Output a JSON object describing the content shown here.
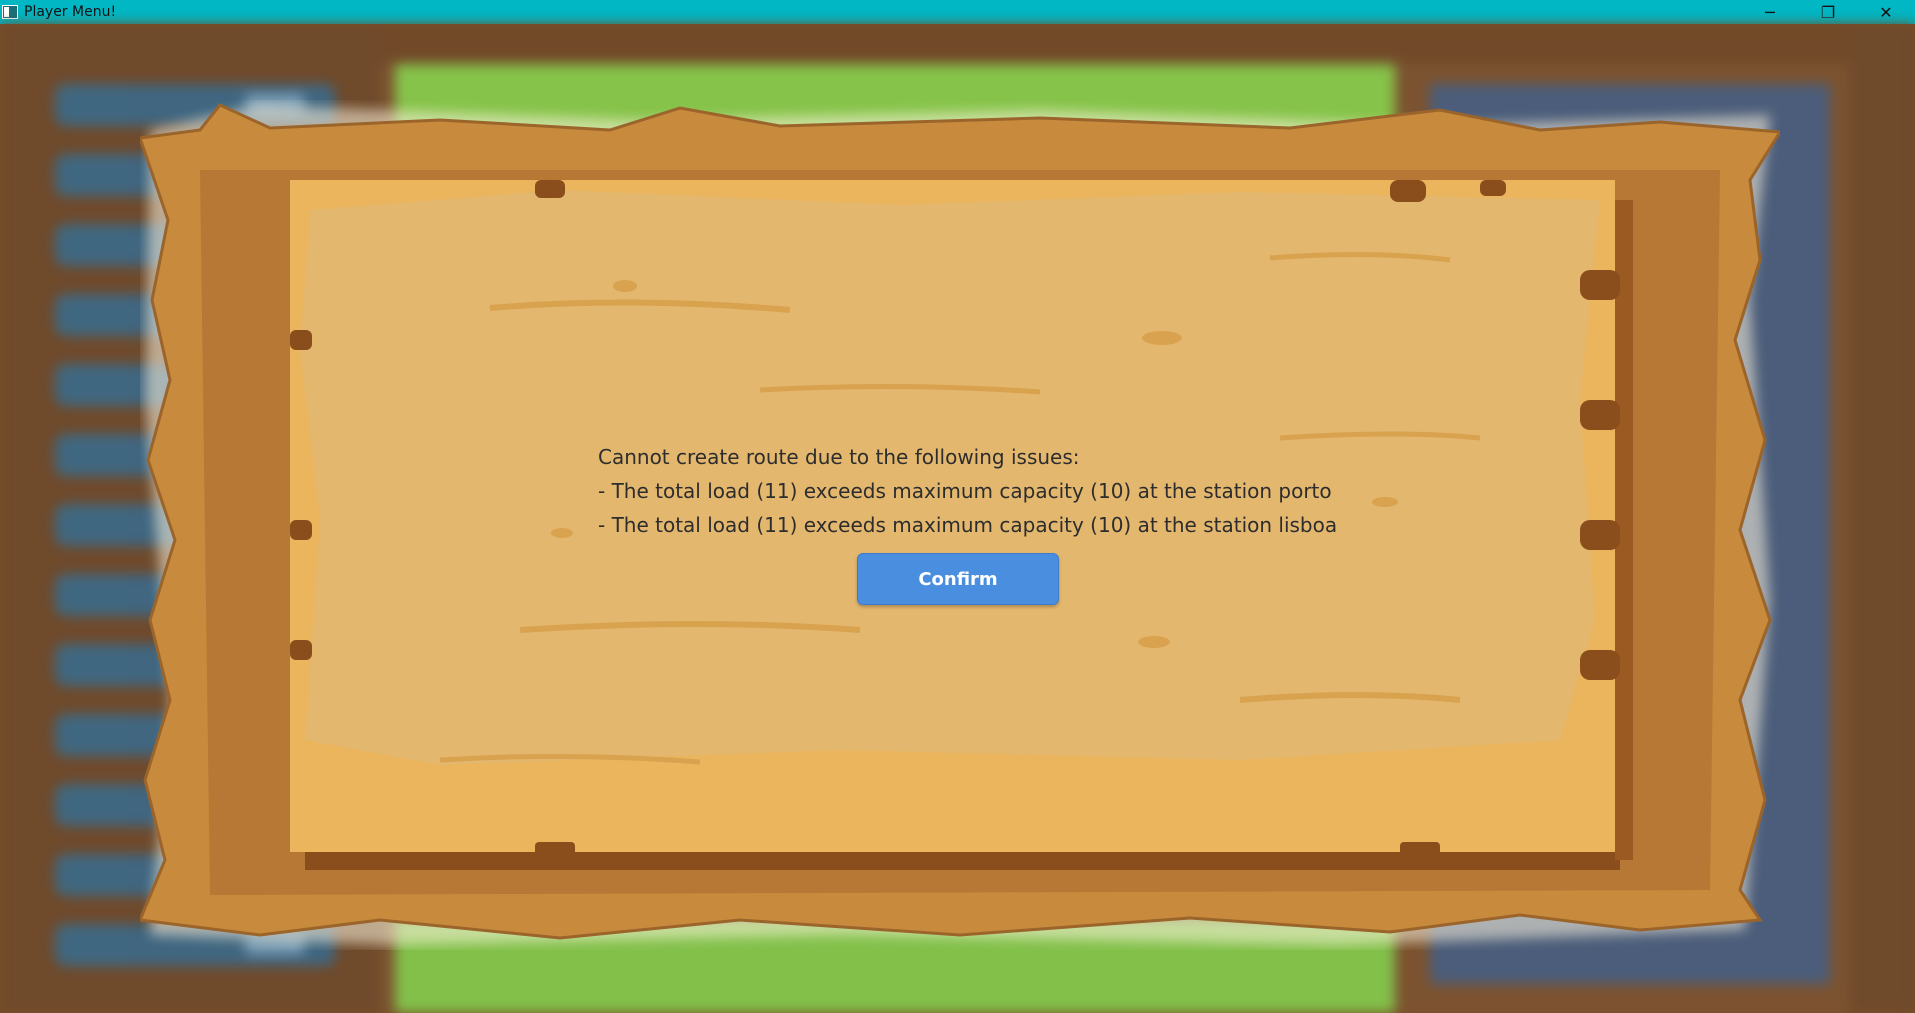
{
  "window": {
    "title": "Player Menu!",
    "minimize_glyph": "─",
    "maximize_glyph": "❐",
    "close_glyph": "✕"
  },
  "dialog": {
    "lines": [
      "Cannot create route due to the following issues:",
      "- The total load (11) exceeds maximum capacity (10) at the station porto",
      "- The total load (11) exceeds maximum capacity (10) at the station lisboa"
    ],
    "confirm_label": "Confirm"
  },
  "colors": {
    "titlebar": "#00b7c3",
    "confirm_button": "#4a8ee0",
    "board_inner": "#e3b46b",
    "board_frame": "#c88a3c"
  },
  "icons": {
    "app": "app-window-icon",
    "minimize": "minimize-icon",
    "maximize": "restore-icon",
    "close": "close-icon"
  }
}
